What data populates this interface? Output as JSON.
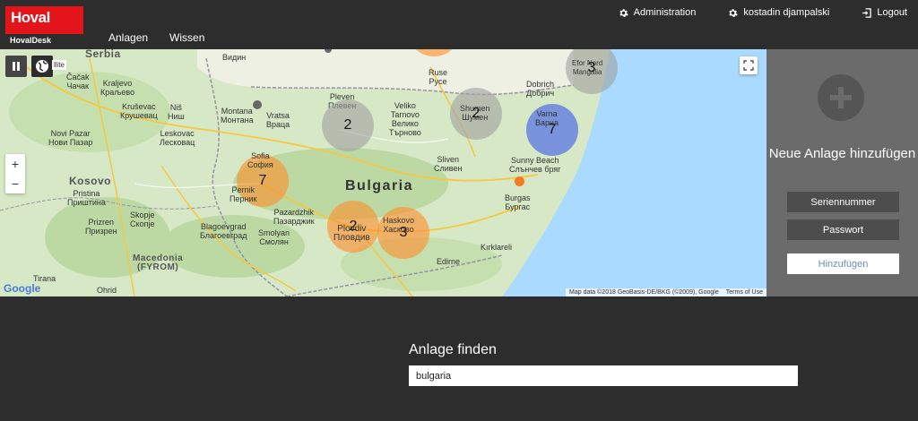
{
  "header": {
    "logo_text": "Hoval",
    "logo_subtitle": "HovalDesk",
    "nav": [
      "Anlagen",
      "Wissen"
    ],
    "admin_label": "Administration",
    "user_label": "kostadin djampalski",
    "logout_label": "Logout"
  },
  "map": {
    "satellite_label": "llite",
    "country_label": "Bulgaria",
    "places": [
      {
        "id": "serbia",
        "label": "Serbia",
        "kind": "big"
      },
      {
        "id": "vidin",
        "label": "Видин"
      },
      {
        "id": "ruse",
        "label": "Ruse\nРусе"
      },
      {
        "id": "dobrich",
        "label": "Dobrich\nДобрич"
      },
      {
        "id": "cacak",
        "label": "Čačak\nЧачак"
      },
      {
        "id": "kraljevo",
        "label": "Kraljevo\nКраљево"
      },
      {
        "id": "krusevac",
        "label": "Kruševac\nКрушевац"
      },
      {
        "id": "nis",
        "label": "Niš\nНиш"
      },
      {
        "id": "pleven",
        "label": "Pleven\nПлевен"
      },
      {
        "id": "montana",
        "label": "Montana\nМонтана"
      },
      {
        "id": "vratsa",
        "label": "Vratsa\nВраца"
      },
      {
        "id": "veliko",
        "label": "Veliko\nTarnovo\nВелико\nТърново"
      },
      {
        "id": "novipazar",
        "label": "Novi Pazar\nНови Пазар"
      },
      {
        "id": "leskovac",
        "label": "Leskovac\nЛесковац"
      },
      {
        "id": "sliven",
        "label": "Sliven\nСливен"
      },
      {
        "id": "sunny",
        "label": "Sunny Beach\nСлънчев бряг"
      },
      {
        "id": "burgas",
        "label": "Burgas\nБургас"
      },
      {
        "id": "kosovo",
        "label": "Kosovo",
        "kind": "big"
      },
      {
        "id": "pristina",
        "label": "Pristina\nПриштина"
      },
      {
        "id": "pazardzhik",
        "label": "Pazardzhik\nПазарджик"
      },
      {
        "id": "prizren",
        "label": "Prizren\nПризрен"
      },
      {
        "id": "skopje",
        "label": "Skopje\nСкопје"
      },
      {
        "id": "blagoevgrad",
        "label": "Blagoevgrad\nБлагоевград"
      },
      {
        "id": "smolyan",
        "label": "Smolyan\nСмолян"
      },
      {
        "id": "kirklareli",
        "label": "Kırklareli"
      },
      {
        "id": "edirne",
        "label": "Edirne"
      },
      {
        "id": "macedonia",
        "label": "Macedonia\n(FYROM)",
        "kind": "big"
      },
      {
        "id": "tirana",
        "label": "Tirana"
      },
      {
        "id": "ohrid",
        "label": "Ohrid"
      }
    ],
    "clusters": [
      {
        "id": "top",
        "count": "",
        "color": "orange"
      },
      {
        "id": "efor",
        "count": "3",
        "color": "grey",
        "label": "Efor Nord\nMangalia"
      },
      {
        "id": "pleven",
        "count": "2",
        "color": "grey",
        "label": ""
      },
      {
        "id": "shumen",
        "count": "2",
        "color": "grey",
        "label": "Shumen\nШумен"
      },
      {
        "id": "varna",
        "count": "7",
        "color": "blue",
        "label": "Varna\nВарна"
      },
      {
        "id": "sofia",
        "count": "7",
        "color": "orange",
        "label": "Sofia\nСофия"
      },
      {
        "id": "pernik",
        "count": "",
        "color": "orange",
        "label": "Pernik\nПерник"
      },
      {
        "id": "plovdiv",
        "count": "2",
        "color": "orange",
        "label": "Plovdiv\nПловдив"
      },
      {
        "id": "haskovo",
        "count": "3",
        "color": "orange",
        "label": "Haskovo\nХасково"
      }
    ],
    "attribution": "Map data ©2018 GeoBasis-DE/BKG (©2009), Google",
    "terms": "Terms of Use",
    "google_logo": "Google"
  },
  "side": {
    "title": "Neue Anlage hinzufügen",
    "serial_placeholder": "Seriennummer",
    "password_placeholder": "Passwort",
    "add_button": "Hinzufügen"
  },
  "find": {
    "title": "Anlage finden",
    "value": "bulgaria"
  },
  "colors": {
    "brand_red": "#e4141b",
    "header_bg": "#2d2d2d",
    "side_bg": "#6b6b6b",
    "cluster_orange": "#ff8c28",
    "cluster_grey": "#a0a0a0",
    "cluster_blue": "#506ee6"
  }
}
